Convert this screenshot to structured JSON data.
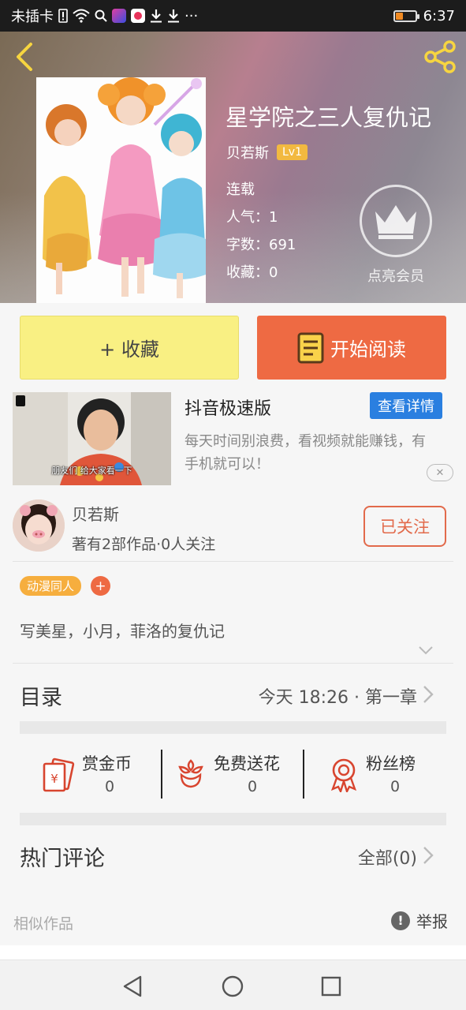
{
  "status_bar": {
    "carrier": "未插卡",
    "time": "6:37",
    "battery_level": 0.35,
    "more": "···"
  },
  "book": {
    "title": "星学院之三人复仇记",
    "author": "贝若斯",
    "level": "Lv1",
    "status": "连载",
    "popularity": "人气：1",
    "word_count": "字数：691",
    "favorites": "收藏：0",
    "vip_label": "点亮会员"
  },
  "actions": {
    "favorite_label": "+ 收藏",
    "read_label": "开始阅读"
  },
  "ad": {
    "title": "抖音极速版",
    "button": "查看详情",
    "description": "每天时间别浪费，看视频就能赚钱，有手机就可以！",
    "thumb_caption": "朋友们 给大家看一下"
  },
  "author_card": {
    "name": "贝若斯",
    "stats": "著有2部作品·0人关注",
    "follow_label": "已关注"
  },
  "tags": {
    "first": "动漫同人",
    "add": "+"
  },
  "synopsis": "写美星，小月，菲洛的复仇记",
  "toc": {
    "label": "目录",
    "latest": "今天 18:26 · 第一章"
  },
  "stats": [
    {
      "label": "赏金币",
      "value": "0",
      "icon": "red-envelope-icon"
    },
    {
      "label": "免费送花",
      "value": "0",
      "icon": "flower-icon"
    },
    {
      "label": "粉丝榜",
      "value": "0",
      "icon": "medal-icon"
    }
  ],
  "comments": {
    "label": "热门评论",
    "all": "全部(0)"
  },
  "similar": {
    "label": "相似作品",
    "report": "举报",
    "report_icon_glyph": "!"
  },
  "colors": {
    "accent_orange": "#ee6a43",
    "fav_yellow": "#f9f083",
    "ad_blue": "#2a7fe0",
    "tag_orange": "#f6ae3e",
    "icon_red": "#d8452f"
  }
}
